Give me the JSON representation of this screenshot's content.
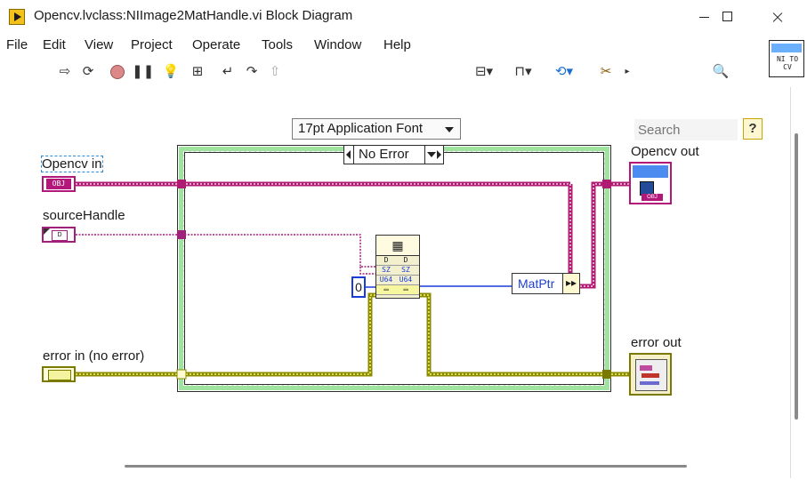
{
  "window": {
    "title": "Opencv.lvclass:NIImage2MatHandle.vi Block Diagram",
    "icon": "labview-vi-icon"
  },
  "menu": {
    "items": [
      {
        "label": "File"
      },
      {
        "label": "Edit"
      },
      {
        "label": "View"
      },
      {
        "label": "Project"
      },
      {
        "label": "Operate"
      },
      {
        "label": "Tools"
      },
      {
        "label": "Window"
      },
      {
        "label": "Help"
      }
    ]
  },
  "toolbar": {
    "font_select": "17pt Application Font",
    "search_placeholder": "Search",
    "help_label": "?",
    "vi_icon_text_1": "NI TO",
    "vi_icon_text_2": "CV"
  },
  "diagram": {
    "case_label": "No Error",
    "controls": {
      "opencv_in": {
        "label": "Opencv in",
        "tag": "OBJ"
      },
      "source_handle": {
        "label": "sourceHandle"
      },
      "error_in": {
        "label": "error in (no error)"
      }
    },
    "indicators": {
      "opencv_out": {
        "label": "Opencv out",
        "tag": "OBJ"
      },
      "error_out": {
        "label": "error out"
      }
    },
    "constant_zero": "0",
    "node_rows": [
      [
        "D",
        "D"
      ],
      [
        "SZ",
        "SZ"
      ],
      [
        "U64",
        "U64"
      ]
    ],
    "matptr_label": "MatPtr"
  },
  "colors": {
    "class_wire": "#b01a72",
    "error_wire": "#8b8b00",
    "numeric_wire": "#1a3cd8",
    "case_frame": "#9fe39f"
  }
}
